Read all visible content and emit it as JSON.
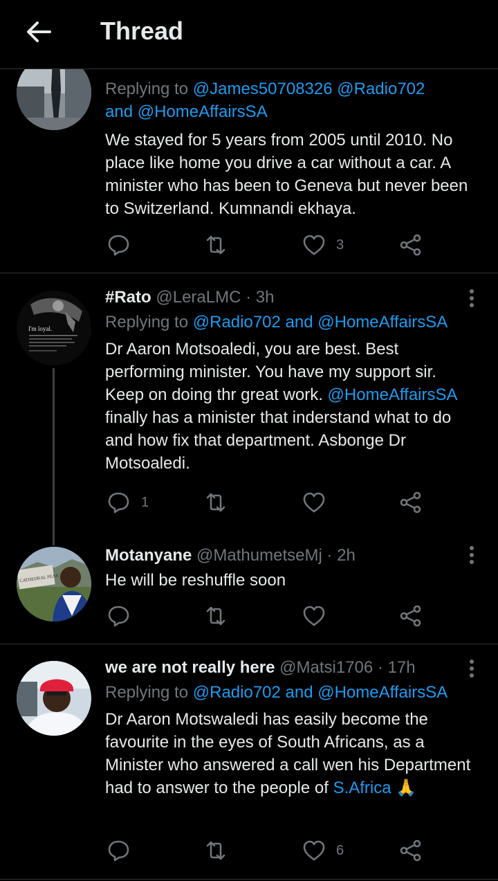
{
  "header": {
    "title": "Thread"
  },
  "tweets": [
    {
      "replying_prefix": "Replying to ",
      "replying_to_1": "@James50708326 @Radio702",
      "replying_and": "and ",
      "replying_to_2": "@HomeAffairsSA",
      "text": "We stayed for 5 years from 2005 until 2010. No place like home you drive a car without a car. A minister who has been to Geneva but never been to Switzerland. Kumnandi ekhaya.",
      "likes": "3"
    },
    {
      "name": "#Rato",
      "handle": "@LeraLMC",
      "dot": "·",
      "time": "3h",
      "replying_prefix": "Replying to ",
      "replying_to": "@Radio702 and @HomeAffairsSA",
      "text_1": "Dr Aaron Motsoaledi, you are best. Best performing minister. You have my support sir. Keep on doing thr great work.",
      "text_mention": "@HomeAffairsSA",
      "text_2": "finally has a minister that inderstand what to do and how fix that department. Asbonge Dr Motsoaledi.",
      "replies": "1",
      "avatar_caption": "I'm loyal."
    },
    {
      "name": "Motanyane",
      "handle": "@MathumetseMj",
      "dot": "·",
      "time": "2h",
      "text": "He will be reshuffle soon",
      "avatar_sign": "CATHEDRAL PEAK"
    },
    {
      "name": "we are not really here",
      "handle": "@Matsi1706",
      "dot": "·",
      "time": "17h",
      "replying_prefix": "Replying to ",
      "replying_to": "@Radio702 and @HomeAffairsSA",
      "text": "Dr Aaron Motswaledi has easily become the favourite in the eyes of South Africans, as a Minister who answered a call wen his Department had to answer to the people of",
      "text_link": "S.Africa",
      "emoji": "🙏",
      "likes": "6"
    }
  ],
  "icons": {
    "back": "arrow-left-icon",
    "reply": "reply-icon",
    "retweet": "retweet-icon",
    "like": "heart-icon",
    "share": "share-icon",
    "more": "more-vertical-icon"
  },
  "colors": {
    "background": "#000000",
    "text": "#e7e9ea",
    "secondary": "#71767b",
    "accent": "#1d9bf0",
    "divider": "#2f3336"
  }
}
